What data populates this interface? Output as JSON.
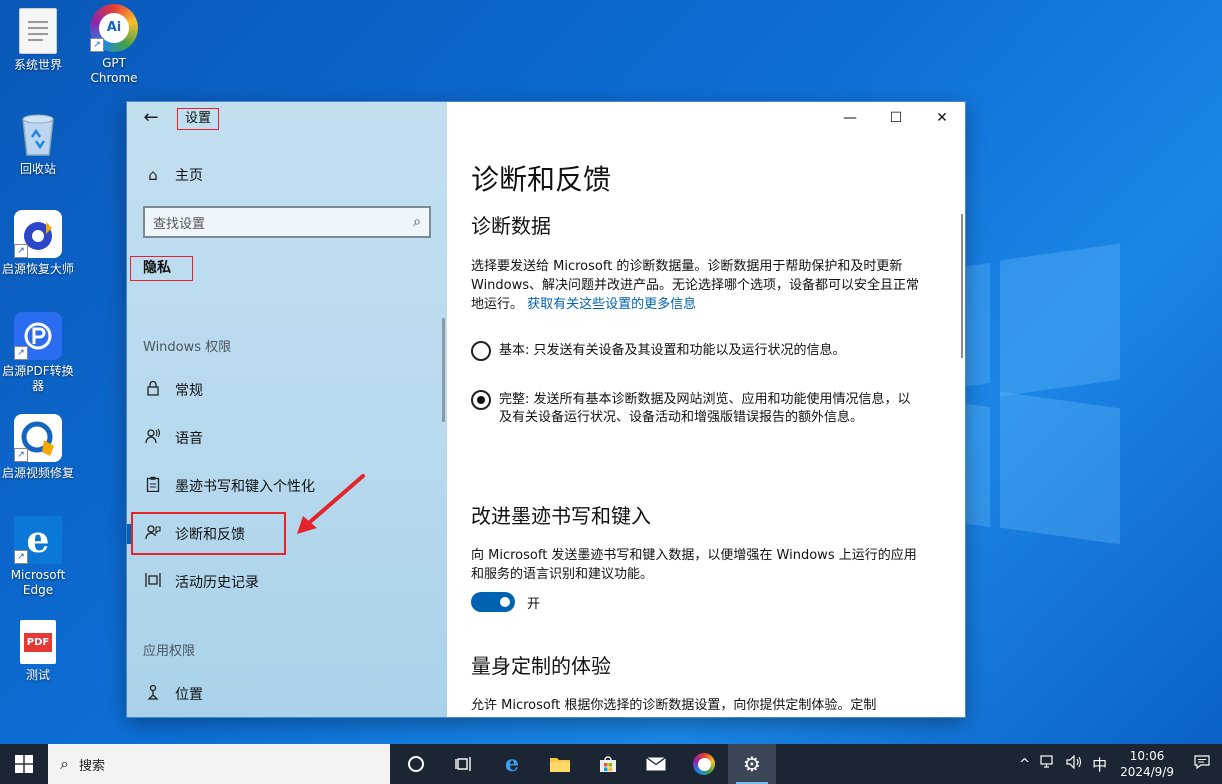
{
  "desktop": {
    "icons": [
      {
        "label": "系统世界"
      },
      {
        "label": "GPT\nChrome"
      },
      {
        "label": "回收站"
      },
      {
        "label": "启源恢复大师"
      },
      {
        "label": "启源PDF转换\n器"
      },
      {
        "label": "启源视频修复"
      },
      {
        "label": "Microsoft\nEdge"
      },
      {
        "label": "测试"
      }
    ],
    "gpt_badge": "Ai",
    "pdf_badge": "PDF"
  },
  "window": {
    "title": "设置",
    "back_glyph": "←",
    "minimize_glyph": "—",
    "maximize_glyph": "☐",
    "close_glyph": "✕"
  },
  "sidebar": {
    "home_label": "主页",
    "search_placeholder": "查找设置",
    "section_title": "隐私",
    "group_windows": "Windows 权限",
    "items": [
      {
        "label": "常规",
        "icon": "lock-icon"
      },
      {
        "label": "语音",
        "icon": "speech-icon"
      },
      {
        "label": "墨迹书写和键入个性化",
        "icon": "clipboard-icon"
      },
      {
        "label": "诊断和反馈",
        "icon": "feedback-icon",
        "active": true
      },
      {
        "label": "活动历史记录",
        "icon": "timeline-icon"
      }
    ],
    "group_apps": "应用权限",
    "app_items": [
      {
        "label": "位置",
        "icon": "location-icon"
      }
    ]
  },
  "content": {
    "page_title": "诊断和反馈",
    "diag_heading": "诊断数据",
    "diag_desc": "选择要发送给 Microsoft 的诊断数据量。诊断数据用于帮助保护和及时更新 Windows、解决问题并改进产品。无论选择哪个选项，设备都可以安全且正常地运行。",
    "diag_link": "获取有关这些设置的更多信息",
    "option_basic": "基本: 只发送有关设备及其设置和功能以及运行状况的信息。",
    "option_full": "完整: 发送所有基本诊断数据及网站浏览、应用和功能使用情况信息，以及有关设备运行状况、设备活动和增强版错误报告的额外信息。",
    "selected_option": "full",
    "ink_heading": "改进墨迹书写和键入",
    "ink_desc": "向 Microsoft 发送墨迹书写和键入数据，以便增强在 Windows 上运行的应用和服务的语言识别和建议功能。",
    "ink_toggle_state": "开",
    "tailored_heading": "量身定制的体验",
    "tailored_desc": "允许 Microsoft 根据你选择的诊断数据设置，向你提供定制体验。定制"
  },
  "taskbar": {
    "search_placeholder": "搜索",
    "tray": {
      "chevron": "^",
      "ime": "中",
      "time": "10:06",
      "date": "2024/9/9"
    }
  },
  "colors": {
    "accent": "#0063b1",
    "highlight_red": "#e5232b",
    "taskbar": "#1b2533"
  }
}
